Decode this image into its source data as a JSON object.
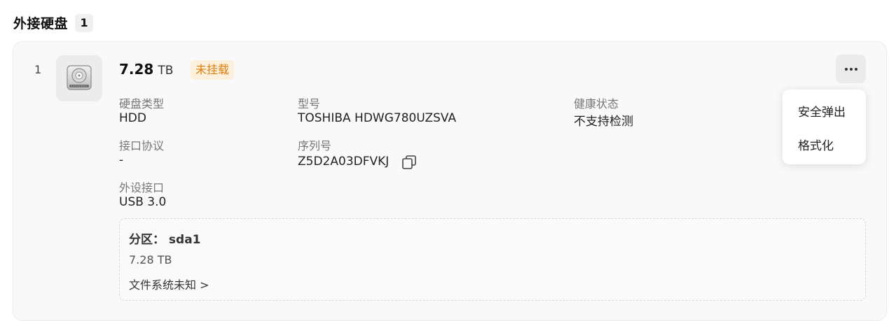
{
  "section": {
    "title": "外接硬盘",
    "count": "1"
  },
  "disk": {
    "index": "1",
    "capacity_value": "7.28",
    "capacity_unit": "TB",
    "status": "未挂载",
    "info": {
      "disk_type_label": "硬盘类型",
      "disk_type_value": "HDD",
      "model_label": "型号",
      "model_value": "TOSHIBA HDWG780UZSVA",
      "health_label": "健康状态",
      "health_value": "不支持检测",
      "interface_label": "接口协议",
      "interface_value": "-",
      "serial_label": "序列号",
      "serial_value": "Z5D2A03DFVKJ",
      "port_label": "外设接口",
      "port_value": "USB 3.0"
    },
    "partition": {
      "title": "分区： sda1",
      "size": "7.28 TB",
      "filesystem": "文件系统未知 >"
    }
  },
  "menu": {
    "items": [
      "安全弹出",
      "格式化"
    ]
  },
  "colors": {
    "badge_text": "#e07e10",
    "badge_bg": "#fdf0dc",
    "card_bg": "#f9f9f9"
  },
  "icons": {
    "disk": "hard-disk-icon",
    "copy": "copy-icon",
    "more": "more-horizontal-icon"
  }
}
